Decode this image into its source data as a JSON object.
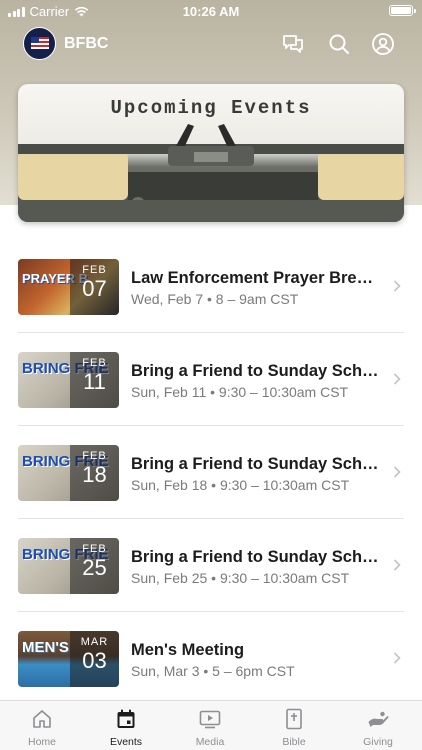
{
  "status_bar": {
    "carrier": "Carrier",
    "time": "10:26 AM"
  },
  "header": {
    "title": "BFBC",
    "icons": [
      "chat-icon",
      "search-icon",
      "profile-icon"
    ]
  },
  "hero": {
    "title": "Upcoming Events"
  },
  "events": [
    {
      "title": "Law Enforcement Prayer Brea…",
      "subtitle": "Wed, Feb 7 • 8 – 9am CST",
      "month": "FEB",
      "day": "07",
      "thumb_text": "PRAYER B"
    },
    {
      "title": "Bring a Friend to Sunday Scho…",
      "subtitle": "Sun, Feb 11 • 9:30 – 10:30am CST",
      "month": "FEB",
      "day": "11",
      "thumb_text": "BRING FRIE"
    },
    {
      "title": "Bring a Friend to Sunday Scho…",
      "subtitle": "Sun, Feb 18 • 9:30 – 10:30am CST",
      "month": "FEB",
      "day": "18",
      "thumb_text": "BRING FRIE"
    },
    {
      "title": "Bring a Friend to Sunday Scho…",
      "subtitle": "Sun, Feb 25 • 9:30 – 10:30am CST",
      "month": "FEB",
      "day": "25",
      "thumb_text": "BRING FRIE"
    },
    {
      "title": "Men's Meeting",
      "subtitle": "Sun, Mar 3 • 5 – 6pm CST",
      "month": "MAR",
      "day": "03",
      "thumb_text": "MEN'S"
    }
  ],
  "tabs": [
    {
      "label": "Home",
      "icon": "home-icon",
      "active": false
    },
    {
      "label": "Events",
      "icon": "calendar-icon",
      "active": true
    },
    {
      "label": "Media",
      "icon": "media-icon",
      "active": false
    },
    {
      "label": "Bible",
      "icon": "bible-icon",
      "active": false
    },
    {
      "label": "Giving",
      "icon": "giving-icon",
      "active": false
    }
  ],
  "colors": {
    "accent_active": "#1c1c1e",
    "tab_inactive": "#8e8e93",
    "subtitle": "#7a7a7e"
  }
}
